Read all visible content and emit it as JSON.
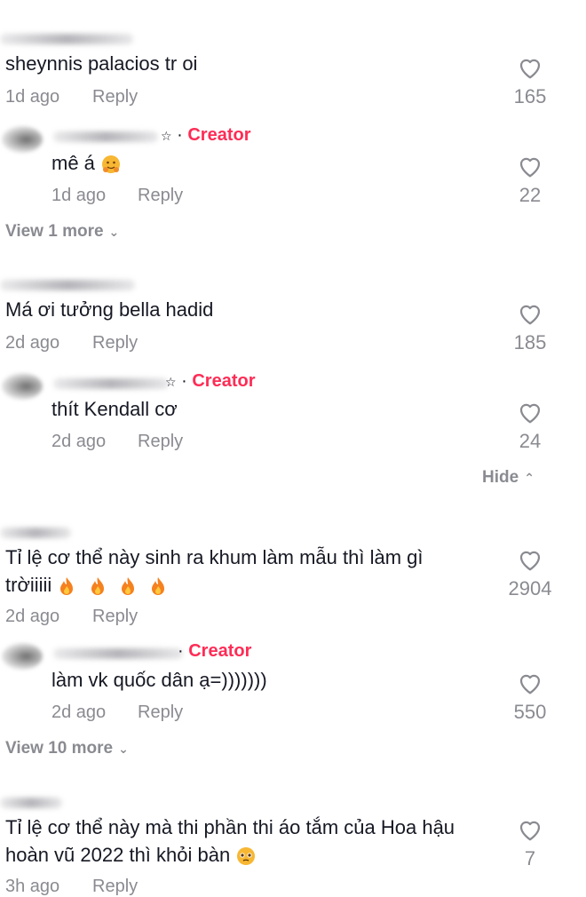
{
  "comments": [
    {
      "text": "sheynnis palacios tr oi",
      "time": "1d ago",
      "reply": "Reply",
      "likes": "165",
      "replies": [
        {
          "creator_label": "Creator",
          "text": "mê á",
          "time": "1d ago",
          "reply": "Reply",
          "likes": "22"
        }
      ],
      "view_more": "View 1 more"
    },
    {
      "text": "Má ơi tưởng bella hadid",
      "time": "2d ago",
      "reply": "Reply",
      "likes": "185",
      "replies": [
        {
          "creator_label": "Creator",
          "text": "thít Kendall cơ",
          "time": "2d ago",
          "reply": "Reply",
          "likes": "24"
        }
      ],
      "hide": "Hide"
    },
    {
      "text_line1": "Tỉ lệ cơ thể này sinh ra khum làm mẫu thì làm gì",
      "text_line2": "trờiiiii",
      "emoji": "fire-emoji",
      "time": "2d ago",
      "reply": "Reply",
      "likes": "2904",
      "replies": [
        {
          "creator_label": "Creator",
          "text": "làm vk quốc dân ạ=)))))))",
          "time": "2d ago",
          "reply": "Reply",
          "likes": "550"
        }
      ],
      "view_more": "View 10 more"
    },
    {
      "text_line1": "Tỉ lệ cơ thể này mà thi phần thi áo tắm của Hoa hậu",
      "text_line2": "hoàn vũ 2022 thì khỏi bàn",
      "emoji": "pleading-face-emoji",
      "time": "3h ago",
      "reply": "Reply",
      "likes": "7"
    }
  ],
  "icons": {
    "like": "heart-outline-icon",
    "expand": "chevron-down-icon",
    "collapse": "chevron-up-icon"
  },
  "colors": {
    "creator": "#fe2c55",
    "muted": "#8a8b91",
    "text": "#161823"
  }
}
